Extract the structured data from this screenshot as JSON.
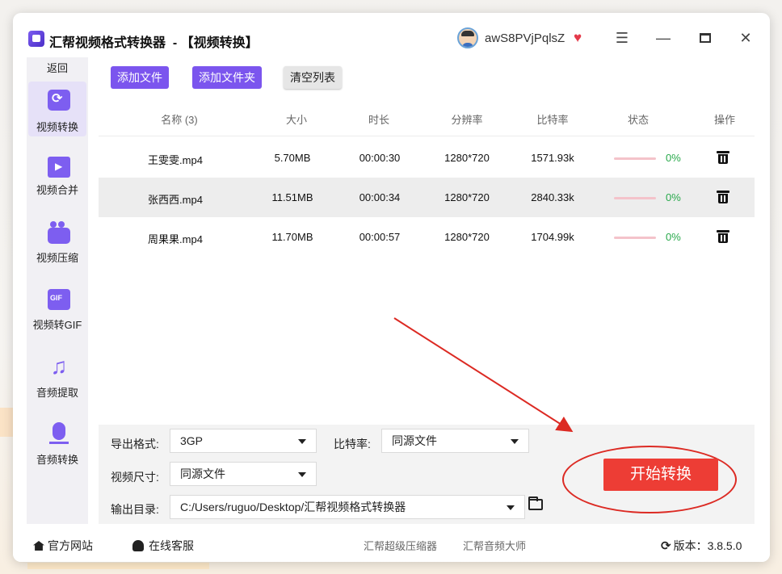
{
  "window": {
    "title": "汇帮视频格式转换器  - 【视频转换】",
    "username": "awS8PVjPqlsZ",
    "icons": [
      "app-icon",
      "avatar",
      "vip-heart-icon",
      "menu-icon",
      "minimize-icon",
      "maximize-icon",
      "close-icon"
    ]
  },
  "sidebar": {
    "back_label": "返回",
    "items": [
      {
        "label": "视频转换",
        "icon": "video-convert-icon",
        "active": true
      },
      {
        "label": "视频合并",
        "icon": "video-merge-icon",
        "active": false
      },
      {
        "label": "视频压缩",
        "icon": "video-compress-icon",
        "active": false
      },
      {
        "label": "视频转GIF",
        "icon": "gif-icon",
        "active": false
      },
      {
        "label": "音频提取",
        "icon": "music-note-icon",
        "active": false
      },
      {
        "label": "音频转换",
        "icon": "microphone-icon",
        "active": false
      }
    ]
  },
  "toolbar": {
    "add_file": "添加文件",
    "add_folder": "添加文件夹",
    "clear_list": "清空列表"
  },
  "table": {
    "headers": [
      "名称 (3)",
      "大小",
      "时长",
      "分辨率",
      "比特率",
      "状态",
      "操作"
    ],
    "rows": [
      {
        "name": "王雯雯.mp4",
        "size": "5.70MB",
        "duration": "00:00:30",
        "resolution": "1280*720",
        "bitrate": "1571.93k",
        "progress": "0%"
      },
      {
        "name": "张西西.mp4",
        "size": "11.51MB",
        "duration": "00:00:34",
        "resolution": "1280*720",
        "bitrate": "2840.33k",
        "progress": "0%"
      },
      {
        "name": "周果果.mp4",
        "size": "11.70MB",
        "duration": "00:00:57",
        "resolution": "1280*720",
        "bitrate": "1704.99k",
        "progress": "0%"
      }
    ]
  },
  "settings": {
    "format_label": "导出格式:",
    "format_value": "3GP",
    "bitrate_label": "比特率:",
    "bitrate_value": "同源文件",
    "size_label": "视频尺寸:",
    "size_value": "同源文件",
    "output_label": "输出目录:",
    "output_value": "C:/Users/ruguo/Desktop/汇帮视频格式转换器",
    "start_button": "开始转换"
  },
  "statusbar": {
    "website": "官方网站",
    "service": "在线客服",
    "link1": "汇帮超级压缩器",
    "link2": "汇帮音频大师",
    "version_label": "版本：",
    "version": "3.8.5.0"
  },
  "colors": {
    "accent": "#7b55ee",
    "start_button": "#ed3d35",
    "annotation": "#dc2a23",
    "progress_text": "#28a94b"
  }
}
